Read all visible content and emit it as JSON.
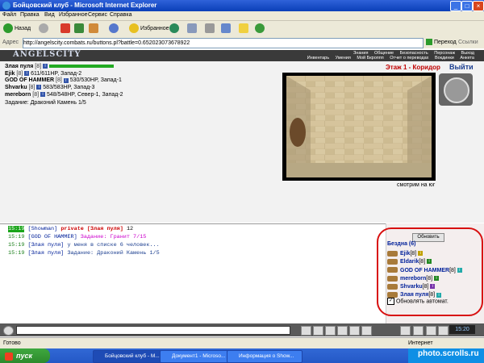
{
  "window": {
    "title": "Бойцовский клуб - Microsoft Internet Explorer"
  },
  "menu": [
    "Файл",
    "Правка",
    "Вид",
    "Избранное",
    "Сервис",
    "Справка"
  ],
  "toolbar": {
    "back": "Назад",
    "favorites": "Избранное"
  },
  "address": {
    "label": "Адрес",
    "url": "http://angelscity.combats.ru/buttons.pl?battle=0.652023073678922",
    "go": "Переход",
    "links": "Ссылки"
  },
  "game": {
    "logo": "ANGELSCITY",
    "nav_top": [
      "Знания",
      "Общение",
      "Безопасность",
      "Персонаж",
      "Выход"
    ],
    "nav_bottom": [
      "Инвентарь",
      "Умения",
      "Мой Бкроппп",
      "Отчет о переводах",
      "Вокдинки",
      "Анкета"
    ],
    "players": [
      {
        "name": "Злая пуля",
        "level": "[8]",
        "info": ""
      },
      {
        "name": "Ejik",
        "level": "[8]",
        "info": "611/611HP, Запад-2"
      },
      {
        "name": "GOD OF HAMMER",
        "level": "[8]",
        "info": "530/530HP, Запад-1"
      },
      {
        "name": "Shvarku",
        "level": "[8]",
        "info": "583/583HP, Запад-3"
      },
      {
        "name": "mereborn",
        "level": "[8]",
        "info": "548/548HP, Север-1, Запад-2"
      }
    ],
    "quest": "Задание: Драконий Камень 1/5",
    "location": "Этаж 1 - Коридор",
    "exit": "Выйти",
    "facing": "смотрим на юг"
  },
  "chat": [
    {
      "time": "15:19",
      "from": "[Showman]",
      "kind": "private",
      "to": "[Злая пуля]",
      "text": "12"
    },
    {
      "time": "15:19",
      "from": "[GOD OF HAMMER]",
      "text": "Задание: Гранит 7/15"
    },
    {
      "time": "15:19",
      "from": "[Злая пуля]",
      "text": "у меня в списке 6 человек..."
    },
    {
      "time": "15:19",
      "from": "[Злая пуля]",
      "text": "Задание: Драконий Камень 1/5"
    }
  ],
  "party": {
    "refresh": "Обновить",
    "title": "Бездна (6)",
    "members": [
      {
        "name": "Ejik",
        "level": "[8]"
      },
      {
        "name": "Eldarik",
        "level": "[8]"
      },
      {
        "name": "GOD OF HAMMER",
        "level": "[8]"
      },
      {
        "name": "mereborn",
        "level": "[8]"
      },
      {
        "name": "Shvarku",
        "level": "[8]"
      },
      {
        "name": "Злая пуля",
        "level": "[8]"
      }
    ],
    "auto_update": "Обновлять автомат."
  },
  "clock": "15:20",
  "status": {
    "done": "Готово",
    "zone": "Интернет"
  },
  "taskbar": {
    "start": "пуск",
    "tasks": [
      "Бойцовский клуб - M...",
      "Документ1 - Microso...",
      "Информация о Show..."
    ],
    "watermark": "photo.scrolls.ru"
  },
  "colors": {
    "title_bar": "#0a3fb8",
    "location": "#c00000",
    "annotation_circle": "#d81010"
  }
}
